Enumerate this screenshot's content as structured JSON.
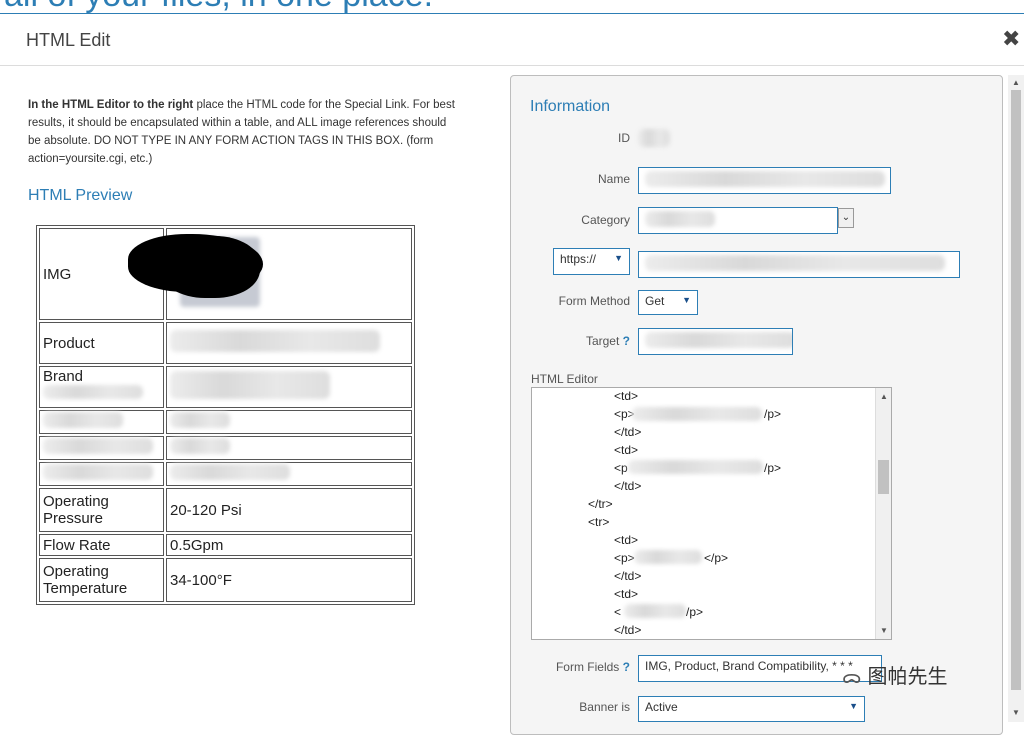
{
  "banner": {
    "text": "all of your files, in one place."
  },
  "dialog": {
    "title": "HTML Edit",
    "close_glyph": "✖"
  },
  "intro": {
    "bold": "In the HTML Editor to the right",
    "rest": " place the HTML code for the Special Link. For best results, it should be encapsulated within a table, and ALL image references should be absolute. DO NOT TYPE IN ANY FORM ACTION TAGS IN THIS BOX. (form action=yoursite.cgi, etc.)"
  },
  "preview": {
    "heading": "HTML Preview",
    "rows": [
      {
        "key": "IMG",
        "value": ""
      },
      {
        "key": "Product",
        "value": ""
      },
      {
        "key": "Brand",
        "value": ""
      },
      {
        "key": "",
        "value": ""
      },
      {
        "key": "",
        "value": ""
      },
      {
        "key": "",
        "value": ""
      },
      {
        "key": "Operating Pressure",
        "value": "20-120 Psi"
      },
      {
        "key": "Flow Rate",
        "value": "0.5Gpm"
      },
      {
        "key": "Operating Temperature",
        "value": "34-100°F"
      }
    ]
  },
  "info": {
    "title": "Information",
    "id_label": "ID",
    "name_label": "Name",
    "category_label": "Category",
    "protocol_value": "https://",
    "form_method_label": "Form Method",
    "form_method_value": "Get",
    "target_label": "Target",
    "help_glyph": "?",
    "editor_label": "HTML Editor",
    "editor_lines": [
      "<td>",
      "<p>",
      "/p>",
      "</td>",
      "<td>",
      "<p",
      "/p>",
      "</td>",
      "</tr>",
      "<tr>",
      "<td>",
      "<p>",
      "</p>",
      "</td>",
      "<td>",
      "<",
      "/p>",
      "</td>"
    ],
    "form_fields_label": "Form Fields",
    "form_fields_value": "IMG, Product, Brand Compatibility, * * *",
    "banner_label": "Banner is",
    "banner_value": "Active"
  },
  "watermark": {
    "text": "图帕先生"
  },
  "icons": {
    "dropdown": "chevron-down-icon",
    "close": "close-icon",
    "scroll_up": "arrow-up-icon",
    "scroll_down": "arrow-down-icon",
    "watermark": "wechat-icon"
  },
  "colors": {
    "accent": "#2d7eb5",
    "panel_bg": "#f5f5f5",
    "border": "#bdbdbd"
  }
}
